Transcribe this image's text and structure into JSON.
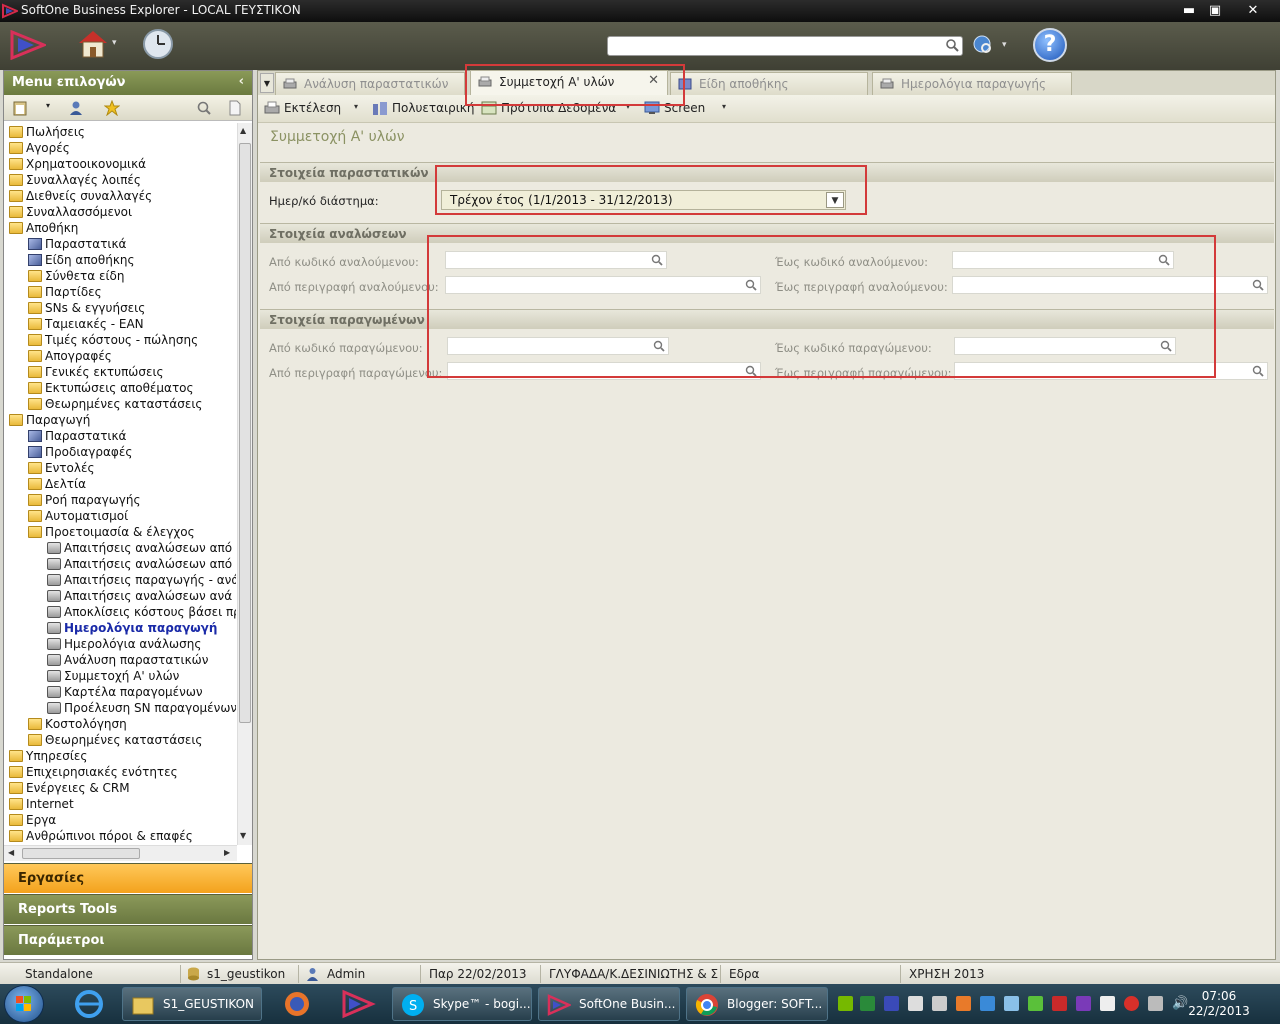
{
  "window": {
    "title": "SoftOne Business Explorer - LOCAL ΓΕΥΣΤΙΚΟΝ",
    "min": "▬",
    "max": "▣",
    "close": "✕"
  },
  "toolbar": {
    "home_caret": "▾",
    "globe_caret": "▾",
    "help": "?"
  },
  "menu": {
    "header": "Menu επιλογών",
    "collapse": "‹",
    "items": [
      {
        "label": "Πωλήσεις",
        "icon": "folder",
        "level": 0
      },
      {
        "label": "Αγορές",
        "icon": "folder",
        "level": 0
      },
      {
        "label": "Χρηματοοικονομικά",
        "icon": "folder",
        "level": 0
      },
      {
        "label": "Συναλλαγές λοιπές",
        "icon": "folder",
        "level": 0
      },
      {
        "label": "Διεθνείς συναλλαγές",
        "icon": "folder",
        "level": 0
      },
      {
        "label": "Συναλλασσόμενοι",
        "icon": "folder",
        "level": 0
      },
      {
        "label": "Αποθήκη",
        "icon": "folder",
        "level": 0
      },
      {
        "label": "Παραστατικά",
        "icon": "cube",
        "level": 1
      },
      {
        "label": "Είδη αποθήκης",
        "icon": "cube",
        "level": 1
      },
      {
        "label": "Σύνθετα είδη",
        "icon": "folder",
        "level": 1
      },
      {
        "label": "Παρτίδες",
        "icon": "folder",
        "level": 1
      },
      {
        "label": "SNs & εγγυήσεις",
        "icon": "folder",
        "level": 1
      },
      {
        "label": "Ταμειακές - EAN",
        "icon": "folder",
        "level": 1
      },
      {
        "label": "Τιμές κόστους - πώλησης",
        "icon": "folder",
        "level": 1
      },
      {
        "label": "Απογραφές",
        "icon": "folder",
        "level": 1
      },
      {
        "label": "Γενικές εκτυπώσεις",
        "icon": "folder",
        "level": 1
      },
      {
        "label": "Εκτυπώσεις αποθέματος",
        "icon": "folder",
        "level": 1
      },
      {
        "label": "Θεωρημένες καταστάσεις",
        "icon": "folder",
        "level": 1
      },
      {
        "label": "Παραγωγή",
        "icon": "folder",
        "level": 0
      },
      {
        "label": "Παραστατικά",
        "icon": "cube",
        "level": 1
      },
      {
        "label": "Προδιαγραφές",
        "icon": "cube",
        "level": 1
      },
      {
        "label": "Εντολές",
        "icon": "folder",
        "level": 1
      },
      {
        "label": "Δελτία",
        "icon": "folder",
        "level": 1
      },
      {
        "label": "Ροή παραγωγής",
        "icon": "folder",
        "level": 1
      },
      {
        "label": "Αυτοματισμοί",
        "icon": "folder",
        "level": 1
      },
      {
        "label": "Προετοιμασία & έλεγχος",
        "icon": "folder",
        "level": 1
      },
      {
        "label": "Απαιτήσεις αναλώσεων από πα",
        "icon": "printer",
        "level": 2
      },
      {
        "label": "Απαιτήσεις αναλώσεων από πα",
        "icon": "printer",
        "level": 2
      },
      {
        "label": "Απαιτήσεις παραγωγής - ανάλω",
        "icon": "printer",
        "level": 2
      },
      {
        "label": "Απαιτήσεις αναλώσεων ανά πα",
        "icon": "printer",
        "level": 2
      },
      {
        "label": "Αποκλίσεις κόστους βάσει προϊ",
        "icon": "printer",
        "level": 2
      },
      {
        "label": "Ημερολόγια παραγωγή",
        "icon": "printer",
        "level": 2,
        "active": true
      },
      {
        "label": "Ημερολόγια ανάλωσης",
        "icon": "printer",
        "level": 2
      },
      {
        "label": "Ανάλυση παραστατικών",
        "icon": "printer",
        "level": 2
      },
      {
        "label": "Συμμετοχή Α' υλών",
        "icon": "printer",
        "level": 2
      },
      {
        "label": "Καρτέλα παραγομένων",
        "icon": "printer",
        "level": 2
      },
      {
        "label": "Προέλευση SN παραγομένων",
        "icon": "printer",
        "level": 2
      },
      {
        "label": "Κοστολόγηση",
        "icon": "folder",
        "level": 1
      },
      {
        "label": "Θεωρημένες καταστάσεις",
        "icon": "folder",
        "level": 1
      },
      {
        "label": "Υπηρεσίες",
        "icon": "folder",
        "level": 0
      },
      {
        "label": "Επιχειρησιακές ενότητες",
        "icon": "folder",
        "level": 0
      },
      {
        "label": "Ενέργειες & CRM",
        "icon": "folder",
        "level": 0
      },
      {
        "label": "Internet",
        "icon": "folder",
        "level": 0
      },
      {
        "label": "Εργα",
        "icon": "folder",
        "level": 0
      },
      {
        "label": "Ανθρώπινοι πόροι & επαφές",
        "icon": "folder",
        "level": 0
      }
    ],
    "nav": {
      "tasks": "Εργασίες",
      "reports": "Reports Tools",
      "params": "Παράμετροι"
    }
  },
  "tabs": [
    {
      "label": "Ανάλυση παραστατικών",
      "active": false
    },
    {
      "label": "Συμμετοχή Α' υλών",
      "active": true
    },
    {
      "label": "Είδη αποθήκης",
      "active": false
    },
    {
      "label": "Ημερολόγια παραγωγής",
      "active": false
    }
  ],
  "tab_close": "✕",
  "actions": {
    "run": "Εκτέλεση",
    "multi": "Πολυεταιρική",
    "templates": "Πρότυπα Δεδομένα",
    "screen": "Screen"
  },
  "form": {
    "title": "Συμμετοχή Α' υλών",
    "sec_docs": "Στοιχεία παραστατικών",
    "date_label": "Ημερ/κό διάστημα:",
    "date_value": "Τρέχον έτος (1/1/2013 - 31/12/2013)",
    "sec_cons": "Στοιχεία αναλώσεων",
    "cons_from_code": "Από κωδικό αναλούμενου:",
    "cons_to_code": "Έως κωδικό αναλούμενου:",
    "cons_from_desc": "Από περιγραφή αναλούμενου:",
    "cons_to_desc": "Έως περιγραφή αναλούμενου:",
    "sec_prod": "Στοιχεία παραγωμένων",
    "prod_from_code": "Από κωδικό παραγώμενου:",
    "prod_to_code": "Έως κωδικό παραγώμενου:",
    "prod_from_desc": "Από περιγραφή παραγώμενου:",
    "prod_to_desc": "Έως περιγραφή παραγώμενου:"
  },
  "status": {
    "mode": "Standalone",
    "db": "s1_geustikon",
    "user": "Admin",
    "date": "Παρ 22/02/2013",
    "branch": "ΓΛΥΦΑΔΑ/Κ.ΔΕΣΙΝΙΩΤΗΣ & ΣΙ",
    "site": "Εδρα",
    "year": "ΧΡΗΣΗ 2013"
  },
  "taskbar": {
    "items": [
      "S1_GEUSTIKON",
      "Skype™ - bogi...",
      "SoftOne Busin...",
      "Blogger: SOFT..."
    ],
    "time": "07:06",
    "date": "22/2/2013"
  },
  "colors": {
    "accent_green": "#6b7a3f",
    "orange": "#f3a21c",
    "highlight": "#d33a3a"
  }
}
